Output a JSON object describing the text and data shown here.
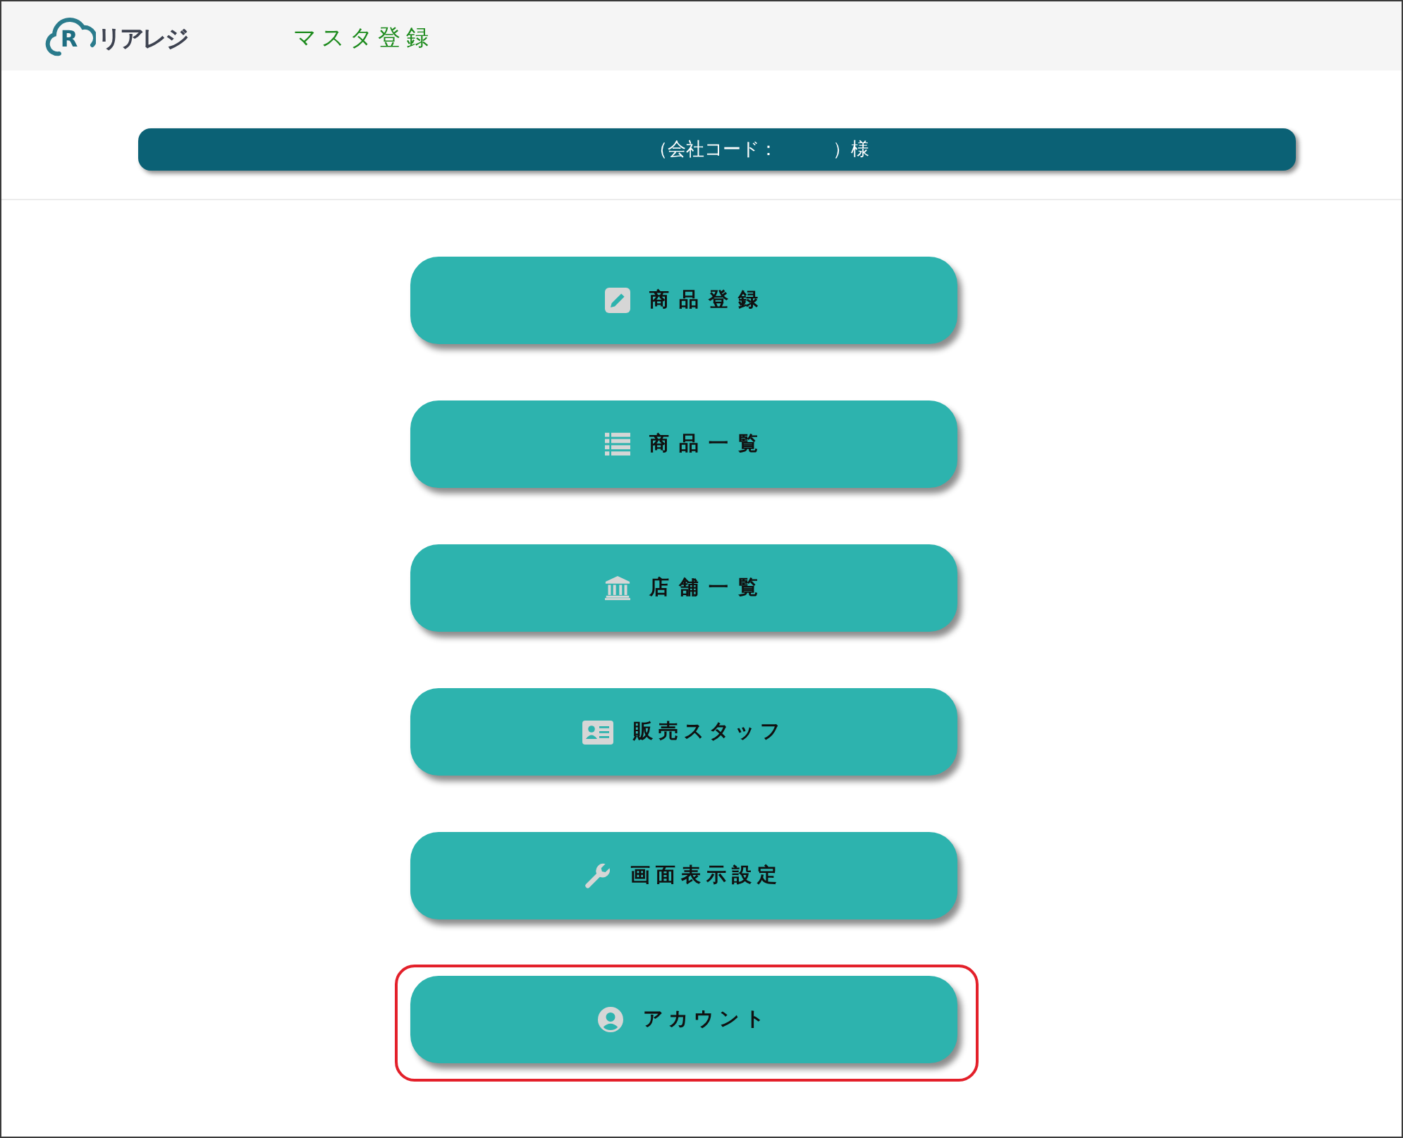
{
  "header": {
    "logo": {
      "mark": "R",
      "text": "リアレジ"
    },
    "title": "マスタ登録"
  },
  "banner": {
    "text": "（会社コード：　　　）様"
  },
  "menu": [
    {
      "label": "商 品 登 録",
      "highlighted": false
    },
    {
      "label": "商 品 一 覧",
      "highlighted": false
    },
    {
      "label": "店 舗 一 覧",
      "highlighted": false
    },
    {
      "label": "販売スタッフ",
      "highlighted": false
    },
    {
      "label": "画面表示設定",
      "highlighted": false
    },
    {
      "label": "アカウント",
      "highlighted": true
    }
  ]
}
